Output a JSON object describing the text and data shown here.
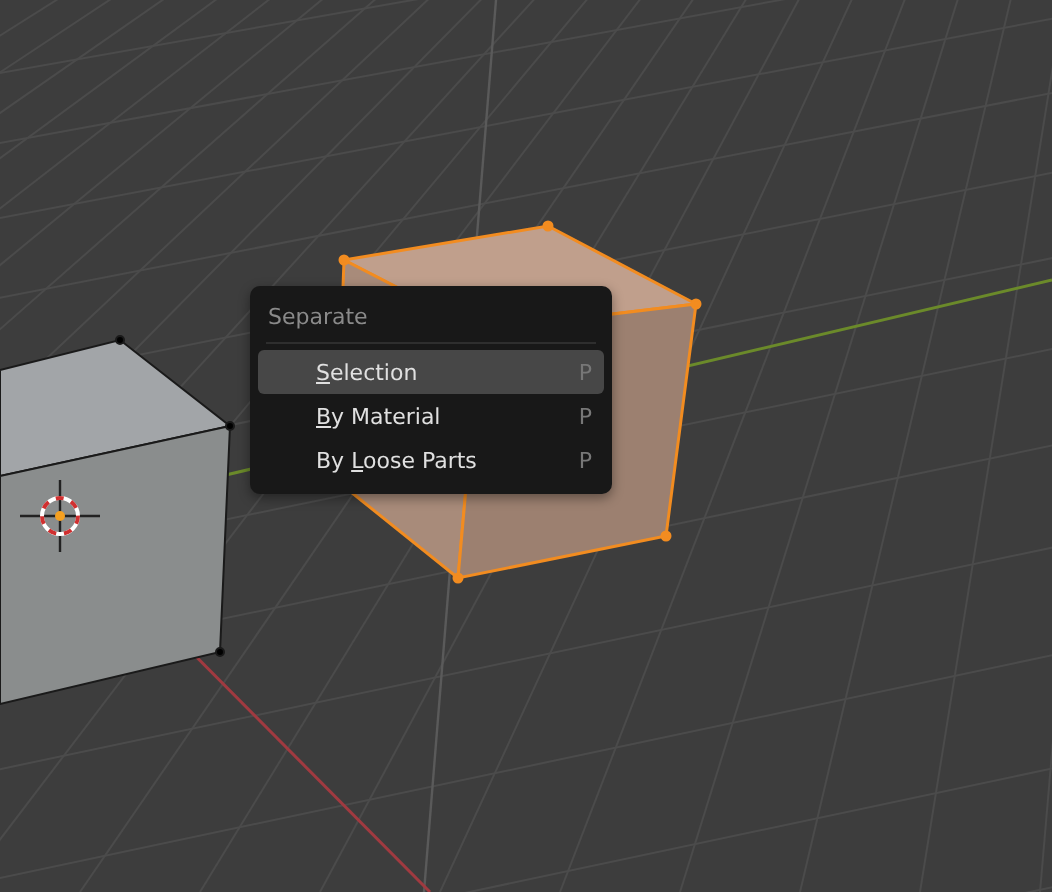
{
  "menu": {
    "title": "Separate",
    "items": [
      {
        "key": "S",
        "after": "election",
        "shortcut": "P",
        "selected": true
      },
      {
        "key": "B",
        "after": "y Material",
        "shortcut": "P",
        "selected": false
      },
      {
        "before": "By ",
        "key": "L",
        "after": "oose Parts",
        "shortcut": "P",
        "selected": false
      }
    ]
  }
}
